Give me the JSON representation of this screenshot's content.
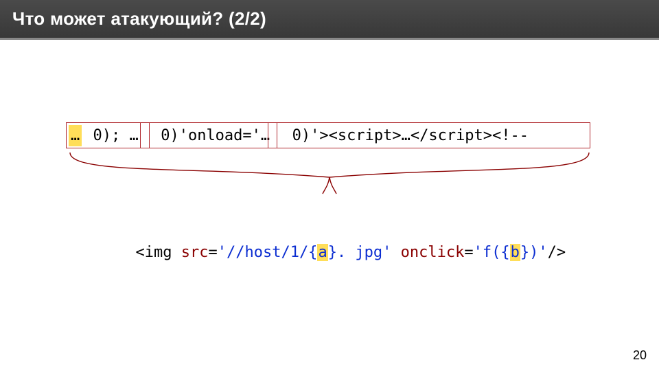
{
  "header": {
    "title": "Что может атакующий? (2/2)"
  },
  "row1": {
    "seg1_hl": "…",
    "seg2": " 0); … ",
    "seg3": " 0)'onload='… ",
    "seg4": " 0)'><script>…</script><!--"
  },
  "row2": {
    "lt": "<",
    "tag": "img",
    "sp1": " ",
    "attr1": "src",
    "eq1": "=",
    "str1_open": "'//host/1/{",
    "str1_hl": "a",
    "str1_close": "}. jpg'",
    "sp2": " ",
    "attr2": "onclick",
    "eq2": "=",
    "str2_open": "'f({",
    "str2_hl": "b",
    "str2_close": "})'",
    "selfclose": "/>"
  },
  "page_number": "20"
}
